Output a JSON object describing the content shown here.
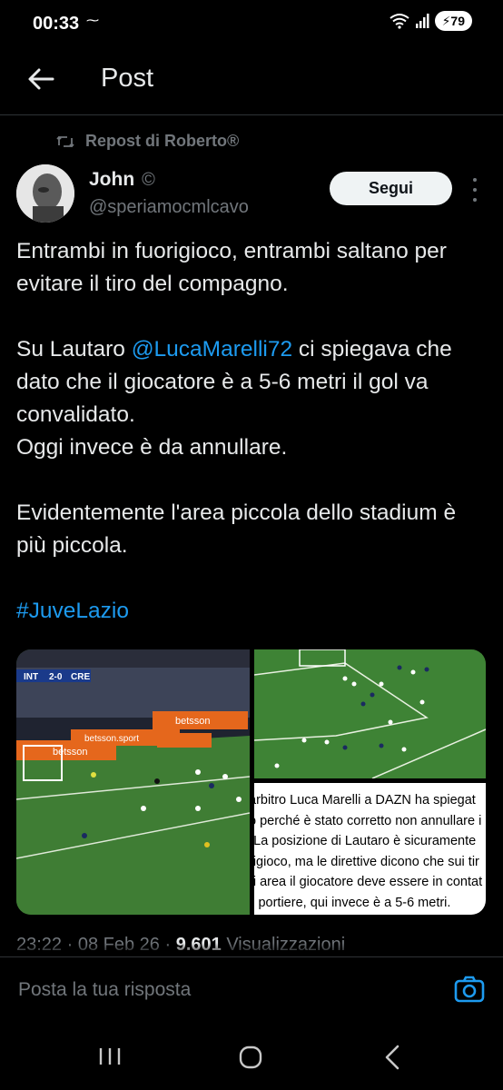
{
  "status_bar": {
    "time": "00:33",
    "battery": "79"
  },
  "header": {
    "title": "Post"
  },
  "repost": {
    "label": "Repost di Roberto®"
  },
  "author": {
    "name": "John",
    "badge": "©",
    "handle": "@speriamocmlcavo"
  },
  "follow_label": "Segui",
  "tweet": {
    "p1": "Entrambi in fuorigioco, entrambi saltano per evitare il tiro del compagno.",
    "p2_prefix": "Su Lautaro ",
    "p2_mention": "@LucaMarelli72",
    "p2_suffix": " ci spiegava che dato che il giocatore è a 5-6 metri il gol va convalidato.",
    "p3": "Oggi invece è da annullare.",
    "p4": "Evidentemente l'area piccola dello stadium è più piccola.",
    "hashtag": "#JuveLazio"
  },
  "media": {
    "scoreboard": {
      "home": "INT",
      "score": "2-0",
      "away": "CRE"
    },
    "ad_text": "betsson",
    "ad_text2": "betsson.sport",
    "quote_lines": [
      " arbitro Luca Marelli a DAZN ha spiegat",
      "ò perché è stato corretto non annullare i",
      " \"La posizione di Lautaro è sicuramente",
      "rigioco, ma le direttive dicono che sui tir",
      "ri area il giocatore deve essere in contat",
      " il portiere, qui invece è a 5-6 metri."
    ]
  },
  "meta": {
    "time": "23:22",
    "date": "08 Feb 26",
    "views": "9.601",
    "views_label": "Visualizzazioni"
  },
  "reply": {
    "placeholder": "Posta la tua risposta"
  },
  "icons": [
    "back-arrow-icon",
    "repost-icon",
    "copyright-icon",
    "more-vertical-icon",
    "camera-icon",
    "recents-icon",
    "home-icon",
    "nav-back-icon"
  ],
  "colors": {
    "link": "#1d9bf0",
    "muted": "#71767b",
    "text": "#e7e9ea",
    "background": "#000000"
  }
}
